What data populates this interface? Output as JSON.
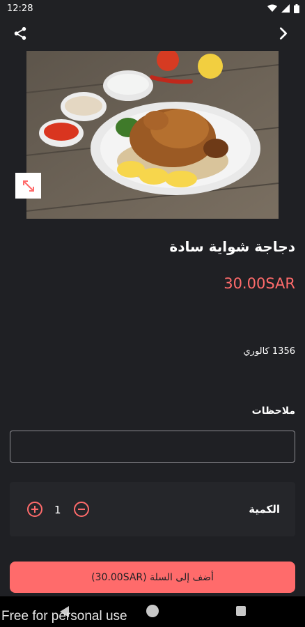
{
  "status_bar": {
    "time": "12:28",
    "icons": [
      "wifi-icon",
      "signal-icon",
      "battery-icon"
    ]
  },
  "top_bar": {
    "share_icon": "share-icon",
    "back_icon": "chevron-right-icon"
  },
  "product": {
    "image": "roasted-chicken-plate-image",
    "title": "دجاجة شواية سادة",
    "price": "30.00SAR",
    "calories": "1356 كالوري"
  },
  "notes": {
    "label": "ملاحظات",
    "value": "",
    "placeholder": ""
  },
  "quantity": {
    "label": "الكمية",
    "value": "1"
  },
  "add_to_cart": {
    "label": "أضف إلى السلة (30.00SAR)"
  },
  "watermark": "Free for personal use",
  "colors": {
    "accent": "#ff6b6b",
    "background": "#1f2024",
    "card": "#25262a"
  }
}
